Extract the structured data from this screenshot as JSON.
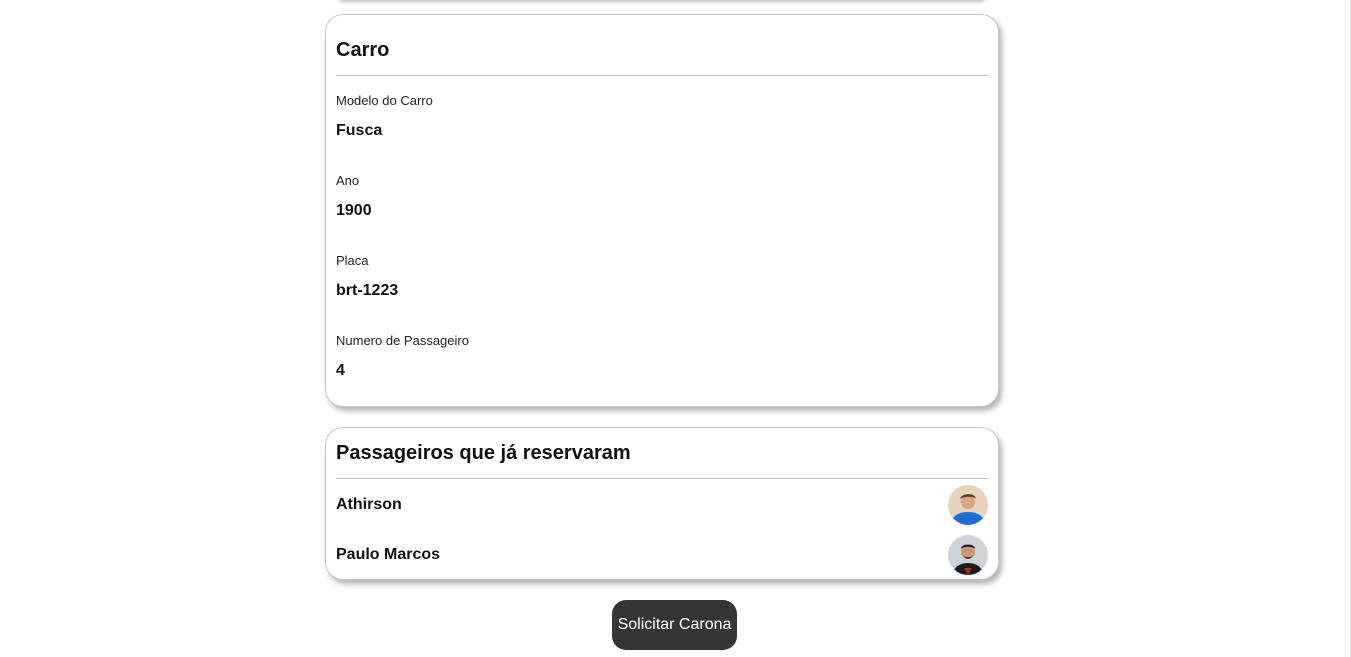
{
  "car": {
    "title": "Carro",
    "fields": [
      {
        "label": "Modelo do Carro",
        "value": "Fusca"
      },
      {
        "label": "Ano",
        "value": "1900"
      },
      {
        "label": "Placa",
        "value": "brt-1223"
      },
      {
        "label": "Numero de Passageiro",
        "value": "4"
      }
    ]
  },
  "passengers": {
    "title": "Passageiros que já reservaram",
    "list": [
      {
        "name": "Athirson",
        "avatar": "user-photo-icon"
      },
      {
        "name": "Paulo Marcos",
        "avatar": "user-photo-icon"
      }
    ]
  },
  "actions": {
    "request_label": "Solicitar Carona"
  },
  "colors": {
    "button_bg": "#353535",
    "button_text": "#ffffff",
    "card_border": "#c7c7c7"
  }
}
